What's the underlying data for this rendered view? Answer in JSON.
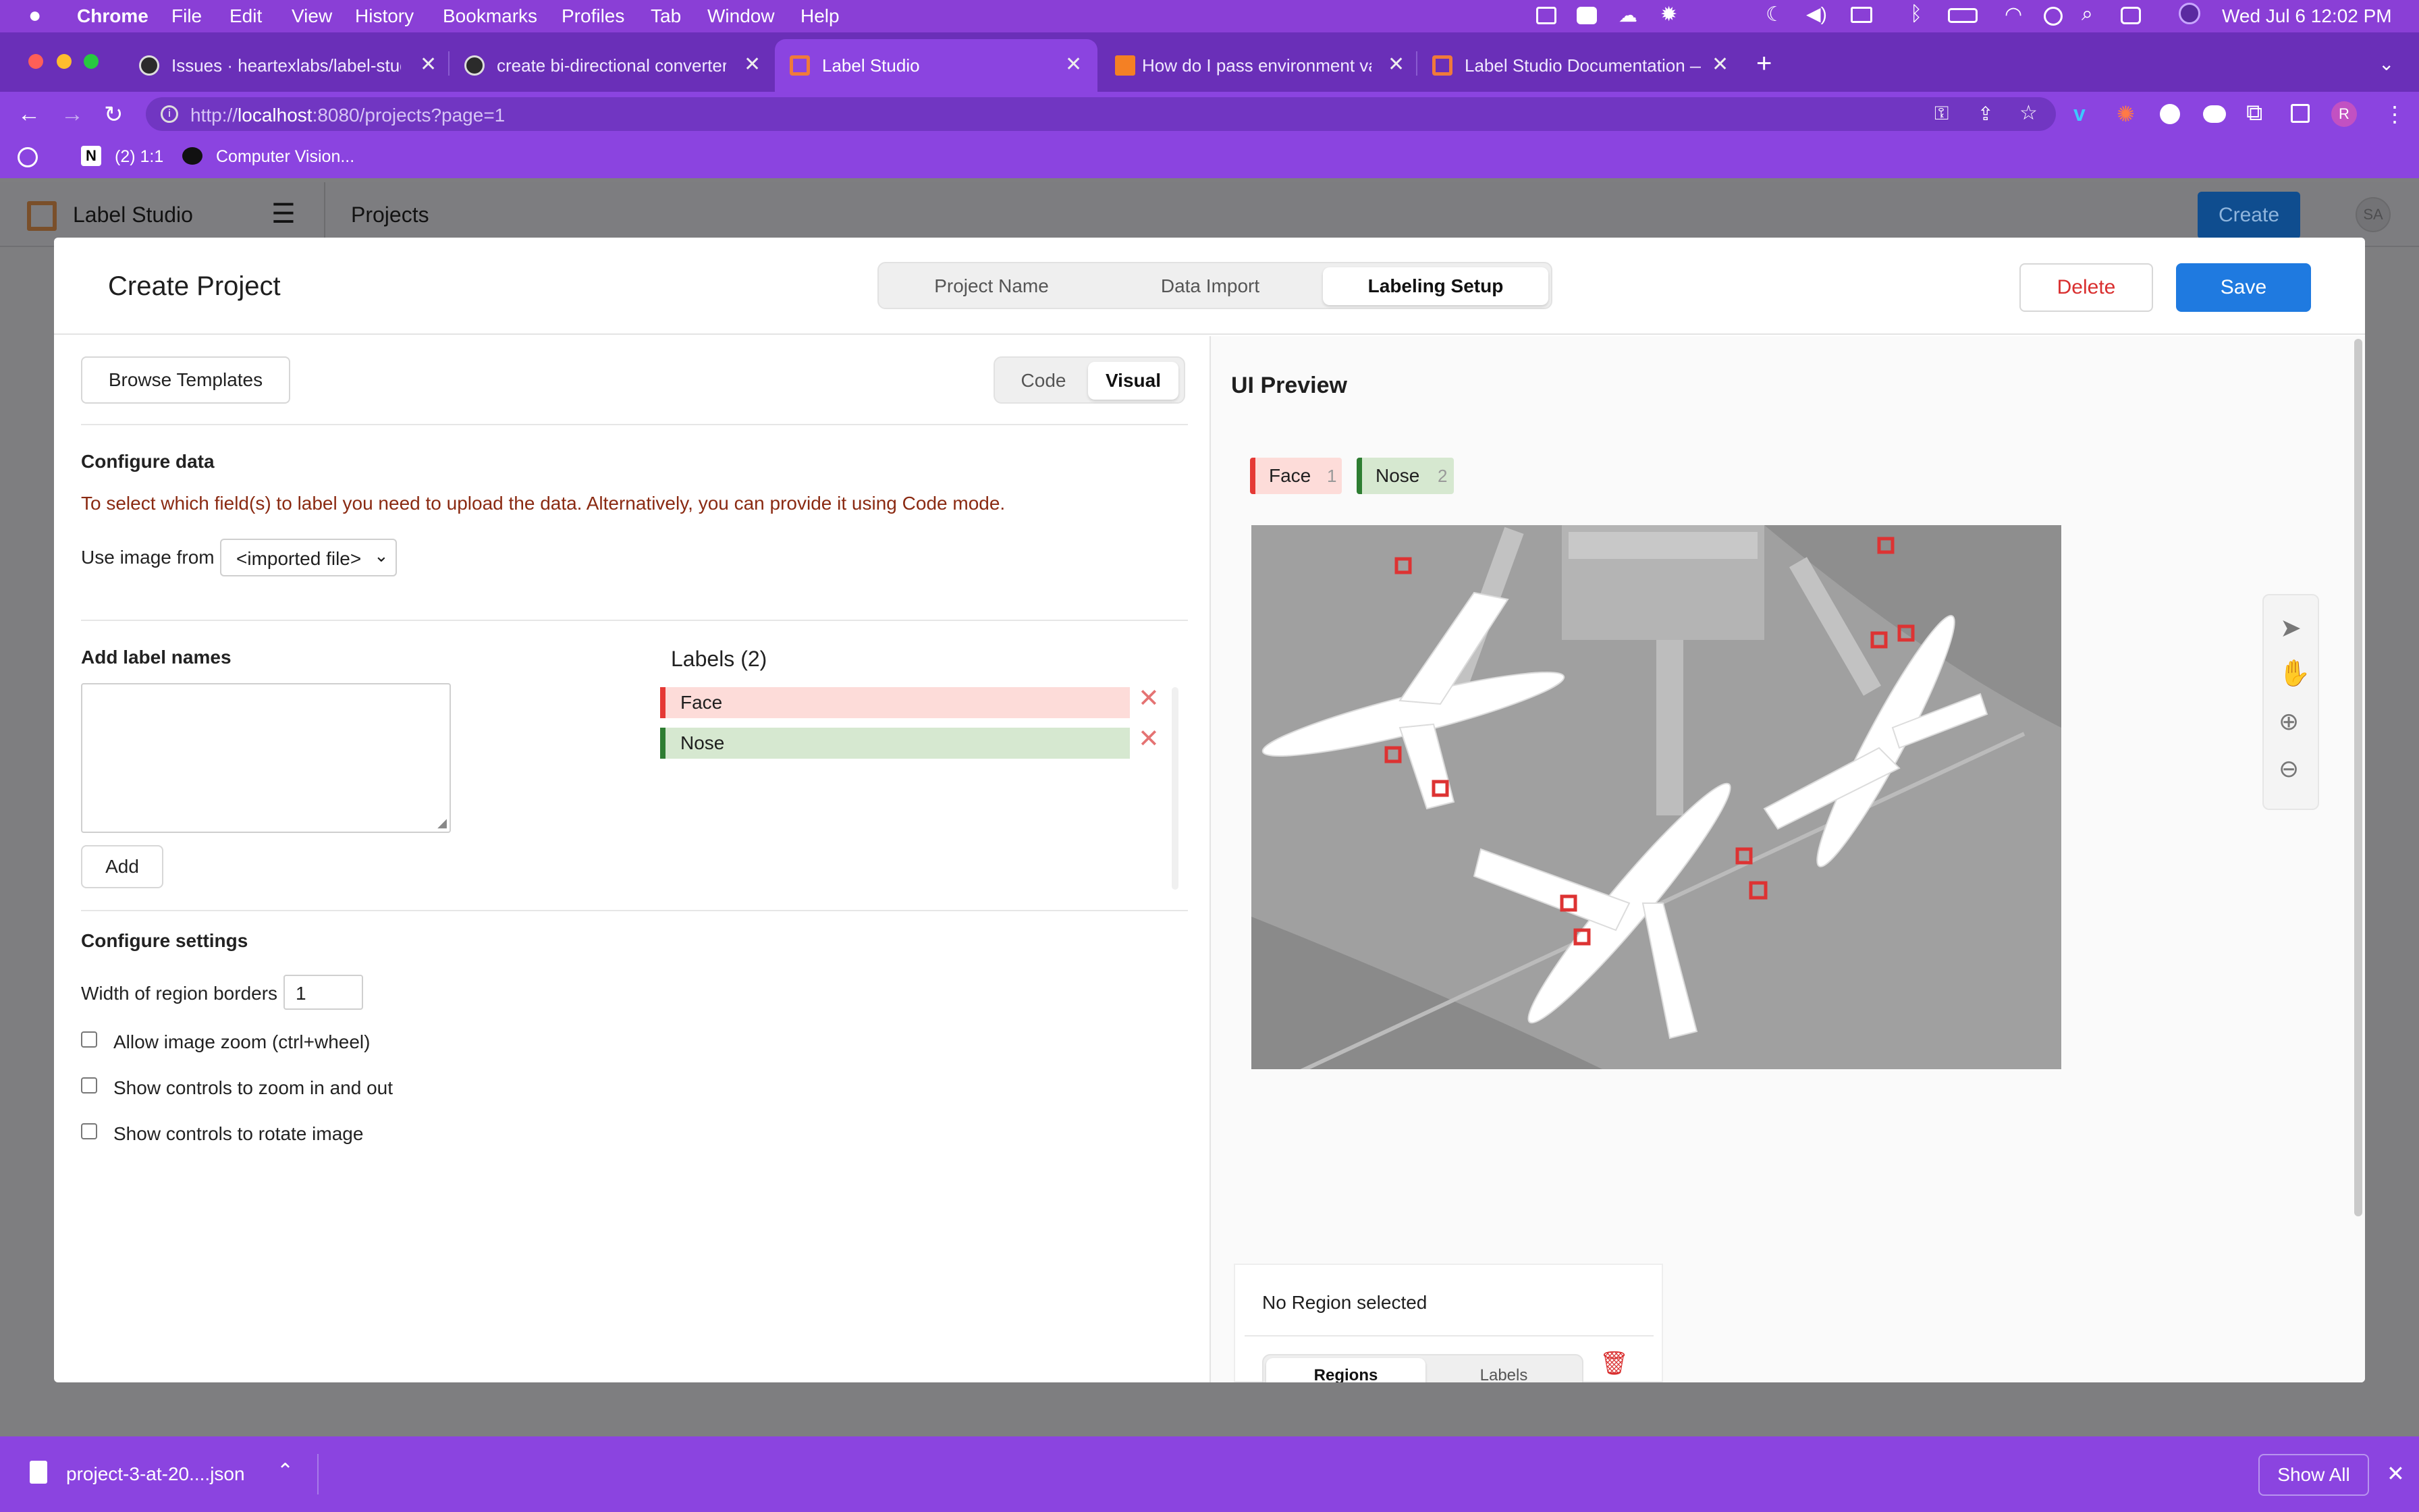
{
  "menubar": {
    "apple_icon": "apple-icon",
    "app": "Chrome",
    "items": [
      "File",
      "Edit",
      "View",
      "History",
      "Bookmarks",
      "Profiles",
      "Tab",
      "Window",
      "Help"
    ],
    "clock": "Wed Jul 6  12:02 PM"
  },
  "tabs": [
    {
      "label": "Issues · heartexlabs/label-stud",
      "icon": "github-icon"
    },
    {
      "label": "create bi-directional converter",
      "icon": "github-icon"
    },
    {
      "label": "Label Studio",
      "icon": "label-studio-icon",
      "active": true
    },
    {
      "label": "How do I pass environment var",
      "icon": "stackoverflow-icon"
    },
    {
      "label": "Label Studio Documentation —",
      "icon": "label-studio-icon"
    }
  ],
  "address": {
    "url_prefix": "http://",
    "url_host": "localhost",
    "url_rest": ":8080/projects?page=1"
  },
  "bookmarks": [
    {
      "label": "(2) 1:1",
      "icon": "notion-icon"
    },
    {
      "label": "Computer Vision...",
      "icon": "bookmark-icon"
    }
  ],
  "app": {
    "brand": "Label Studio",
    "section": "Projects",
    "create_label": "Create",
    "avatar": "SA"
  },
  "modal": {
    "title": "Create Project",
    "steps": [
      "Project Name",
      "Data Import",
      "Labeling Setup"
    ],
    "active_step": "Labeling Setup",
    "delete_label": "Delete",
    "save_label": "Save"
  },
  "left": {
    "browse_templates": "Browse Templates",
    "mode_tabs": [
      "Code",
      "Visual"
    ],
    "active_mode": "Visual",
    "configure_data_title": "Configure data",
    "configure_data_warning": "To select which field(s) to label you need to upload the data. Alternatively, you can provide it using Code mode.",
    "use_image_from_label": "Use image from",
    "use_image_from_value": "<imported file>",
    "add_label_names_title": "Add label names",
    "add_button": "Add",
    "labels_title": "Labels (2)",
    "labels": [
      {
        "name": "Face",
        "color": "#e53935",
        "bg": "#fddcd9"
      },
      {
        "name": "Nose",
        "color": "#2e7d32",
        "bg": "#d6e8d0"
      }
    ],
    "configure_settings_title": "Configure settings",
    "border_width_label": "Width of region borders",
    "border_width_value": "1",
    "checkboxes": [
      {
        "label": "Allow image zoom (ctrl+wheel)",
        "checked": false
      },
      {
        "label": "Show controls to zoom in and out",
        "checked": false
      },
      {
        "label": "Show controls to rotate image",
        "checked": false
      }
    ]
  },
  "preview": {
    "title": "UI Preview",
    "tags": [
      {
        "name": "Face",
        "hotkey": "1",
        "color": "#e53935",
        "bg": "#fddcd9"
      },
      {
        "name": "Nose",
        "hotkey": "2",
        "color": "#2e7d32",
        "bg": "#d6e8d0"
      }
    ],
    "tools": [
      "pointer-icon",
      "hand-icon",
      "zoom-in-icon",
      "zoom-out-icon"
    ],
    "no_region": "No Region selected",
    "panel_tabs": [
      "Regions",
      "Labels"
    ],
    "active_panel_tab": "Regions"
  },
  "download_bar": {
    "file": "project-3-at-20....json",
    "show_all": "Show All"
  },
  "colors": {
    "accent": "#1f7ae0",
    "delete": "#d92f2f",
    "chrome_purple": "#8b44e0"
  }
}
